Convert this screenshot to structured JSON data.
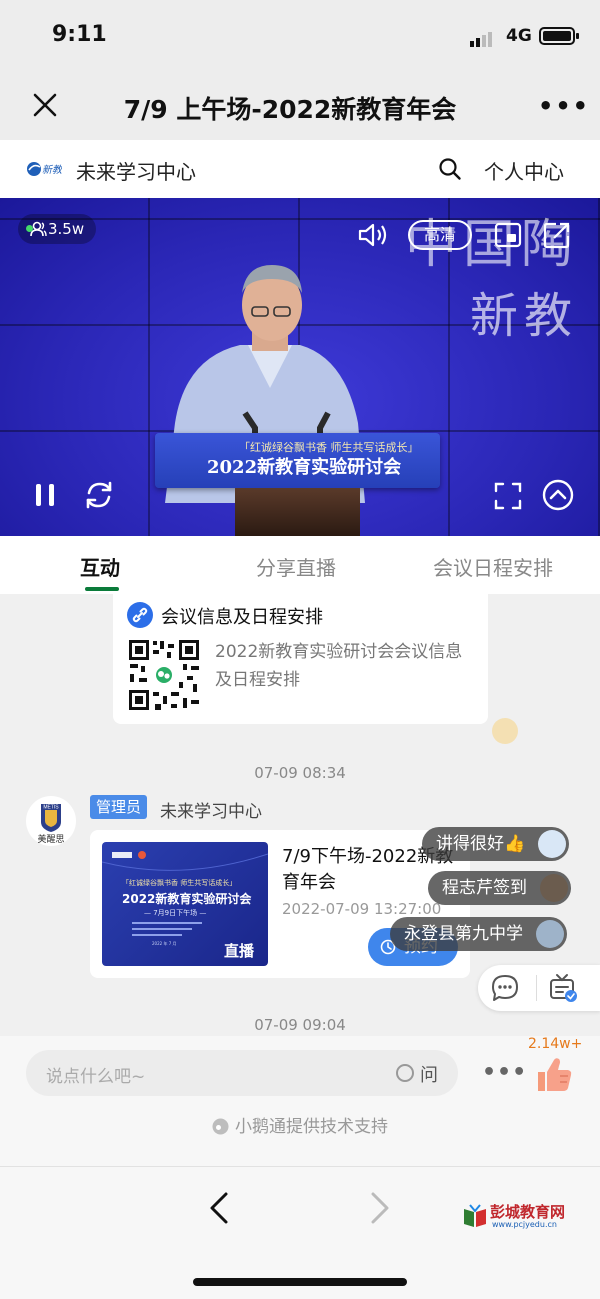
{
  "status_bar": {
    "time": "9:11",
    "network": "4G"
  },
  "nav": {
    "title": "7/9 上午场-2022新教育年会"
  },
  "site": {
    "name": "未来学习中心",
    "personal_center": "个人中心"
  },
  "video": {
    "viewers": "3.5w",
    "quality": "高清",
    "backdrop_line1": "中国陶",
    "backdrop_line2": "新教",
    "podium_subtitle": "「红诚绿谷飘书香  师生共写话成长」",
    "podium_title": "2022新教育实验研讨会"
  },
  "tabs": [
    {
      "label": "互动",
      "active": true
    },
    {
      "label": "分享直播",
      "active": false
    },
    {
      "label": "会议日程安排",
      "active": false
    }
  ],
  "chat": {
    "info_card": {
      "title": "会议信息及日程安排",
      "description": "2022新教育实验研讨会会议信息及日程安排"
    },
    "timestamp1": "07-09 08:34",
    "message": {
      "avatar_label": "美醒思",
      "badge": "管理员",
      "sender": "未来学习中心",
      "card": {
        "poster_line1": "「红诚绿谷飘书香  师生共写话成长」",
        "poster_title": "2022新教育实验研讨会",
        "poster_date": "— 7月9日下午场 —",
        "poster_tag": "直播",
        "title": "7/9下午场-2022新教育年会",
        "datetime": "2022-07-09 13:27:00",
        "reserve_label": "预约"
      }
    },
    "danmu": [
      {
        "text": "讲得很好👍"
      },
      {
        "text": "程志芹签到"
      },
      {
        "text": "永登县第九中学"
      }
    ],
    "timestamp2": "07-09 09:04"
  },
  "input": {
    "placeholder": "说点什么吧~",
    "ask_label": "问",
    "like_count": "2.14w+"
  },
  "support_text": "小鹅通提供技术支持",
  "watermark": {
    "name": "彭城教育网",
    "url": "www.pcjyedu.cn"
  },
  "colors": {
    "accent_green": "#0a7b3a",
    "blue": "#3f86ec",
    "video_bg": "#2b28b8",
    "like_orange": "#e67a1c"
  },
  "icons": [
    "close-icon",
    "more-icon",
    "search-icon",
    "viewers-icon",
    "volume-icon",
    "pip-icon",
    "share-icon",
    "pause-icon",
    "refresh-icon",
    "fullscreen-icon",
    "collapse-up-icon",
    "link-icon",
    "qr-code",
    "clock-icon",
    "comment-icon",
    "notice-icon",
    "thumbs-up-icon",
    "back-icon",
    "forward-icon"
  ]
}
